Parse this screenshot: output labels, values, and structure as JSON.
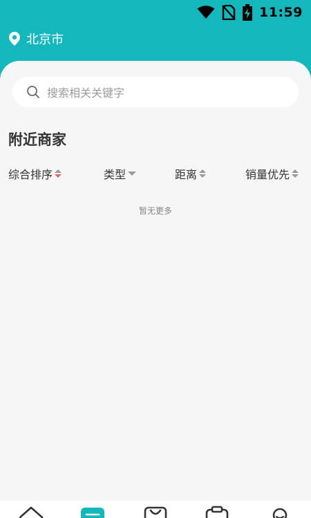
{
  "status_bar": {
    "time": "11:59",
    "icons": [
      "wifi-icon",
      "no-sim-icon",
      "battery-charging-icon"
    ]
  },
  "header": {
    "location": "北京市",
    "location_icon": "location-pin-icon"
  },
  "search": {
    "placeholder": "搜索相关关键字",
    "icon": "search-icon"
  },
  "section": {
    "title": "附近商家"
  },
  "sort_options": [
    {
      "label": "综合排序",
      "indicator": "up-down-arrows",
      "active": true
    },
    {
      "label": "类型",
      "indicator": "dropdown-arrow"
    },
    {
      "label": "距离",
      "indicator": "up-down-arrows"
    },
    {
      "label": "销量优先",
      "indicator": "up-down-arrows"
    }
  ],
  "empty_state": "暂无更多",
  "tab_bar": {
    "tabs": [
      {
        "icon": "home-icon",
        "active": false
      },
      {
        "icon": "list-icon",
        "active": true
      },
      {
        "icon": "shopping-bag-icon",
        "active": false
      },
      {
        "icon": "clipboard-icon",
        "active": false
      },
      {
        "icon": "profile-icon",
        "active": false
      }
    ]
  },
  "colors": {
    "primary": "#14b7bb",
    "background": "#f6f6f6",
    "active_sort_arrow": "#e5675f",
    "tab_inactive": "#333333"
  }
}
